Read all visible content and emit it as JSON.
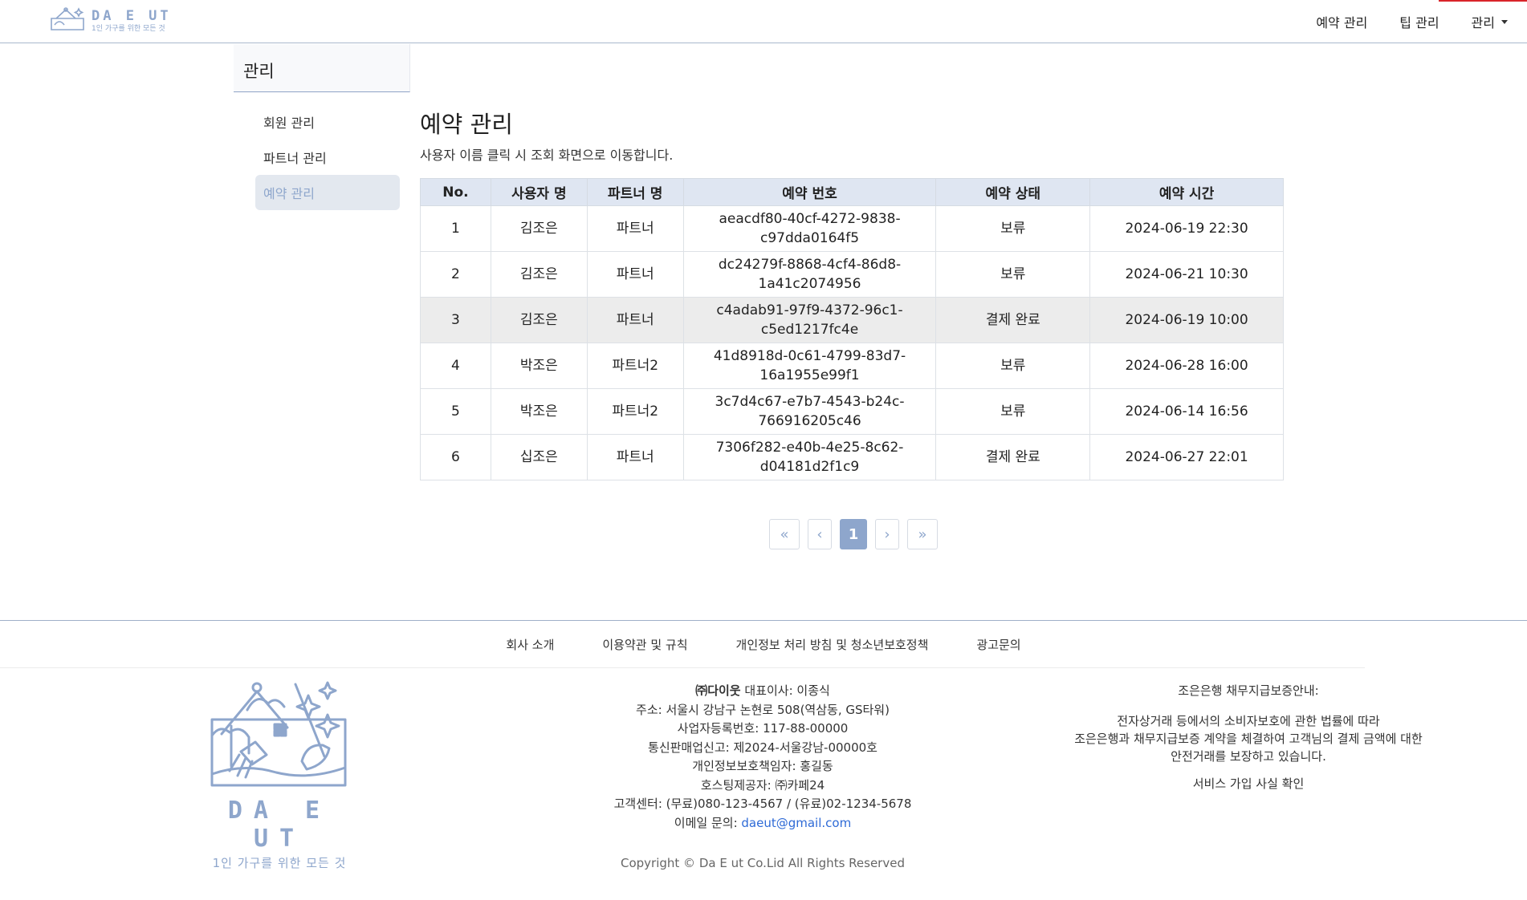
{
  "header": {
    "logo_title": "DA E UT",
    "logo_subtitle": "1인 가구를 위한 모든 것",
    "nav": [
      {
        "label": "예약 관리"
      },
      {
        "label": "팁 관리"
      },
      {
        "label": "관리"
      }
    ]
  },
  "sidebar": {
    "title": "관리",
    "items": [
      {
        "label": "회원 관리"
      },
      {
        "label": "파트너 관리"
      },
      {
        "label": "예약 관리",
        "active": true
      }
    ]
  },
  "main": {
    "title": "예약 관리",
    "description": "사용자 이름 클릭 시 조회 화면으로 이동합니다.",
    "table": {
      "headers": [
        "No.",
        "사용자 명",
        "파트너 명",
        "예약 번호",
        "예약 상태",
        "예약 시간"
      ],
      "rows": [
        {
          "no": "1",
          "user": "김조은",
          "partner": "파트너",
          "code1": "aeacdf80-40cf-4272-9838-",
          "code2": "c97dda0164f5",
          "status": "보류",
          "time": "2024-06-19 22:30"
        },
        {
          "no": "2",
          "user": "김조은",
          "partner": "파트너",
          "code1": "dc24279f-8868-4cf4-86d8-",
          "code2": "1a41c2074956",
          "status": "보류",
          "time": "2024-06-21 10:30"
        },
        {
          "no": "3",
          "user": "김조은",
          "partner": "파트너",
          "code1": "c4adab91-97f9-4372-96c1-",
          "code2": "c5ed1217fc4e",
          "status": "결제 완료",
          "time": "2024-06-19 10:00"
        },
        {
          "no": "4",
          "user": "박조은",
          "partner": "파트너2",
          "code1": "41d8918d-0c61-4799-83d7-",
          "code2": "16a1955e99f1",
          "status": "보류",
          "time": "2024-06-28 16:00"
        },
        {
          "no": "5",
          "user": "박조은",
          "partner": "파트너2",
          "code1": "3c7d4c67-e7b7-4543-b24c-",
          "code2": "766916205c46",
          "status": "보류",
          "time": "2024-06-14 16:56"
        },
        {
          "no": "6",
          "user": "십조은",
          "partner": "파트너",
          "code1": "7306f282-e40b-4e25-8c62-",
          "code2": "d04181d2f1c9",
          "status": "결제 완료",
          "time": "2024-06-27 22:01"
        }
      ]
    },
    "pagination": {
      "first": "«",
      "prev": "‹",
      "current": "1",
      "next": "›",
      "last": "»"
    }
  },
  "footer": {
    "links": [
      "회사 소개",
      "이용약관 및 규칙",
      "개인정보 처리 방침 및 청소년보호정책",
      "광고문의"
    ],
    "logo_title": "DA E UT",
    "logo_subtitle": "1인 가구를 위한 모든 것",
    "company_name": "㈜다이웃",
    "ceo": "대표이사: 이종식",
    "address": "주소: 서울시 강남구 논현로 508(역삼동, GS타워)",
    "business_no": "사업자등록번호: 117-88-00000",
    "ecommerce_no": "통신판매업신고: 제2024-서울강남-00000호",
    "privacy_officer": "개인정보보호책임자: 홍길동",
    "hosting": "호스팅제공자: ㈜카페24",
    "support": "고객센터: (무료)080-123-4567 / (유료)02-1234-5678",
    "email_label": "이메일 문의: ",
    "email": "daeut@gmail.com",
    "copyright": "Copyright © Da E ut Co.Lid All Rights Reserved",
    "bank_title": "조은은행 채무지급보증안내:",
    "bank_line1": "전자상거래 등에서의 소비자보호에 관한 법률에 따라",
    "bank_line2": "조은은행과 채무지급보증 계약을 체결하여 고객님의 결제 금액에 대한",
    "bank_line3": "안전거래를 보장하고 있습니다.",
    "bank_link": "서비스 가입 사실 확인"
  },
  "colors": {
    "brand": "#8ea6cc",
    "pending": "#2a8a2a",
    "paid": "#1a1ad6",
    "table_header_bg": "#dfe6f2"
  }
}
